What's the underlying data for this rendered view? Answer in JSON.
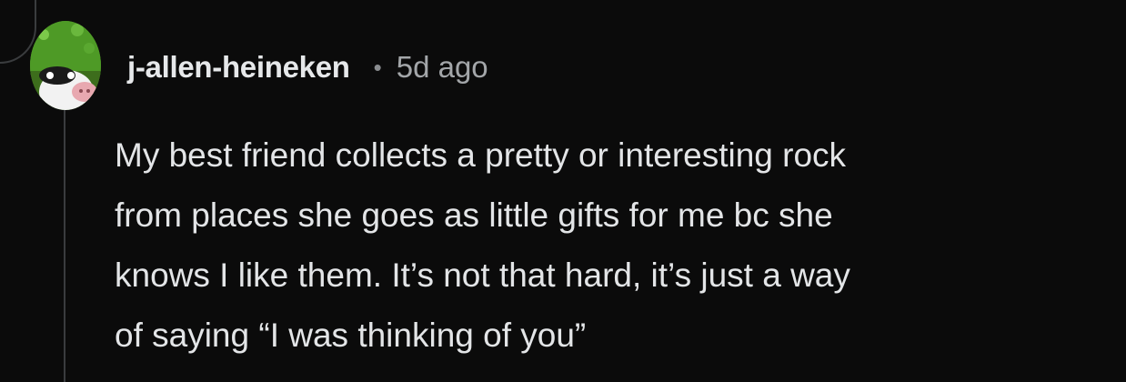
{
  "comment": {
    "author": "j-allen-heineken",
    "separator": "•",
    "timestamp": "5d ago",
    "body_lines": [
      "My best friend collects a pretty or interesting rock",
      "from places she goes as little gifts for me bc she",
      "knows I like them. It’s not that hard, it’s just a way",
      "of saying “I was thinking of you”"
    ]
  },
  "icons": {
    "avatar": "user-avatar-cow"
  },
  "colors": {
    "background": "#0b0b0b",
    "username": "#e6e8ea",
    "timestamp": "#a3a6a9",
    "body": "#e3e5e7",
    "thread_line": "#3a3c3e"
  }
}
